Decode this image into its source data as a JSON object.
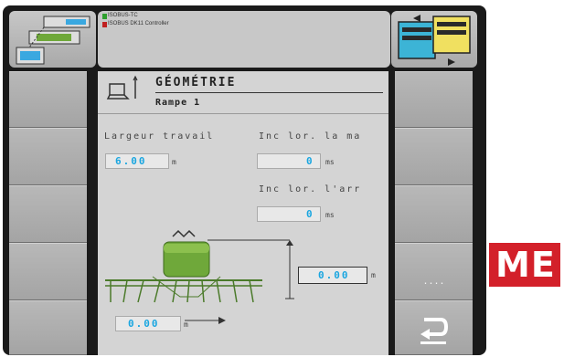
{
  "header": {
    "line1": "ISOBUS-TC",
    "line2": "ISOBUS DK11 Controller"
  },
  "screen": {
    "title": "GÉOMÉTRIE",
    "subtitle": "Rampe 1"
  },
  "fields": {
    "working_width": {
      "label": "Largeur travail",
      "value": "6.00",
      "unit": "m"
    },
    "incl_front": {
      "label": "Inc lor. la ma",
      "value": "0",
      "unit": "ms"
    },
    "incl_rear": {
      "label": "Inc lor. l'arr",
      "value": "0",
      "unit": "ms"
    },
    "height": {
      "value": "0.00",
      "unit": "m"
    },
    "offset": {
      "value": "0.00",
      "unit": "m"
    }
  },
  "softkeys": {
    "more_label": "...."
  },
  "logo": {
    "text": "ME"
  },
  "colors": {
    "value_blue": "#1aa6e0",
    "implement_green": "#6fa83a",
    "logo_red": "#d3202a"
  },
  "icons": {
    "nav_icon": "implement-layout-icon",
    "switch_icon": "switch-screen-icon",
    "back_icon": "return-arrow-icon",
    "title_icon": "geometry-icon"
  }
}
